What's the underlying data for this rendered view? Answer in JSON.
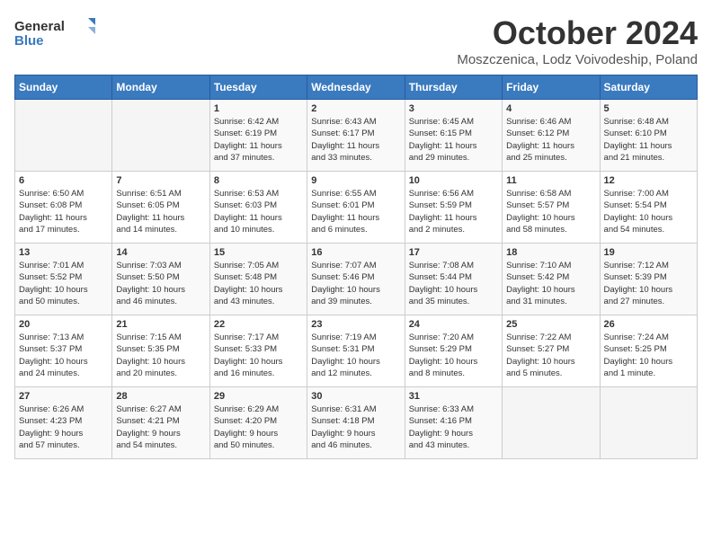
{
  "header": {
    "logo_general": "General",
    "logo_blue": "Blue",
    "month": "October 2024",
    "location": "Moszczenica, Lodz Voivodeship, Poland"
  },
  "weekdays": [
    "Sunday",
    "Monday",
    "Tuesday",
    "Wednesday",
    "Thursday",
    "Friday",
    "Saturday"
  ],
  "weeks": [
    [
      {
        "day": "",
        "info": ""
      },
      {
        "day": "",
        "info": ""
      },
      {
        "day": "1",
        "info": "Sunrise: 6:42 AM\nSunset: 6:19 PM\nDaylight: 11 hours\nand 37 minutes."
      },
      {
        "day": "2",
        "info": "Sunrise: 6:43 AM\nSunset: 6:17 PM\nDaylight: 11 hours\nand 33 minutes."
      },
      {
        "day": "3",
        "info": "Sunrise: 6:45 AM\nSunset: 6:15 PM\nDaylight: 11 hours\nand 29 minutes."
      },
      {
        "day": "4",
        "info": "Sunrise: 6:46 AM\nSunset: 6:12 PM\nDaylight: 11 hours\nand 25 minutes."
      },
      {
        "day": "5",
        "info": "Sunrise: 6:48 AM\nSunset: 6:10 PM\nDaylight: 11 hours\nand 21 minutes."
      }
    ],
    [
      {
        "day": "6",
        "info": "Sunrise: 6:50 AM\nSunset: 6:08 PM\nDaylight: 11 hours\nand 17 minutes."
      },
      {
        "day": "7",
        "info": "Sunrise: 6:51 AM\nSunset: 6:05 PM\nDaylight: 11 hours\nand 14 minutes."
      },
      {
        "day": "8",
        "info": "Sunrise: 6:53 AM\nSunset: 6:03 PM\nDaylight: 11 hours\nand 10 minutes."
      },
      {
        "day": "9",
        "info": "Sunrise: 6:55 AM\nSunset: 6:01 PM\nDaylight: 11 hours\nand 6 minutes."
      },
      {
        "day": "10",
        "info": "Sunrise: 6:56 AM\nSunset: 5:59 PM\nDaylight: 11 hours\nand 2 minutes."
      },
      {
        "day": "11",
        "info": "Sunrise: 6:58 AM\nSunset: 5:57 PM\nDaylight: 10 hours\nand 58 minutes."
      },
      {
        "day": "12",
        "info": "Sunrise: 7:00 AM\nSunset: 5:54 PM\nDaylight: 10 hours\nand 54 minutes."
      }
    ],
    [
      {
        "day": "13",
        "info": "Sunrise: 7:01 AM\nSunset: 5:52 PM\nDaylight: 10 hours\nand 50 minutes."
      },
      {
        "day": "14",
        "info": "Sunrise: 7:03 AM\nSunset: 5:50 PM\nDaylight: 10 hours\nand 46 minutes."
      },
      {
        "day": "15",
        "info": "Sunrise: 7:05 AM\nSunset: 5:48 PM\nDaylight: 10 hours\nand 43 minutes."
      },
      {
        "day": "16",
        "info": "Sunrise: 7:07 AM\nSunset: 5:46 PM\nDaylight: 10 hours\nand 39 minutes."
      },
      {
        "day": "17",
        "info": "Sunrise: 7:08 AM\nSunset: 5:44 PM\nDaylight: 10 hours\nand 35 minutes."
      },
      {
        "day": "18",
        "info": "Sunrise: 7:10 AM\nSunset: 5:42 PM\nDaylight: 10 hours\nand 31 minutes."
      },
      {
        "day": "19",
        "info": "Sunrise: 7:12 AM\nSunset: 5:39 PM\nDaylight: 10 hours\nand 27 minutes."
      }
    ],
    [
      {
        "day": "20",
        "info": "Sunrise: 7:13 AM\nSunset: 5:37 PM\nDaylight: 10 hours\nand 24 minutes."
      },
      {
        "day": "21",
        "info": "Sunrise: 7:15 AM\nSunset: 5:35 PM\nDaylight: 10 hours\nand 20 minutes."
      },
      {
        "day": "22",
        "info": "Sunrise: 7:17 AM\nSunset: 5:33 PM\nDaylight: 10 hours\nand 16 minutes."
      },
      {
        "day": "23",
        "info": "Sunrise: 7:19 AM\nSunset: 5:31 PM\nDaylight: 10 hours\nand 12 minutes."
      },
      {
        "day": "24",
        "info": "Sunrise: 7:20 AM\nSunset: 5:29 PM\nDaylight: 10 hours\nand 8 minutes."
      },
      {
        "day": "25",
        "info": "Sunrise: 7:22 AM\nSunset: 5:27 PM\nDaylight: 10 hours\nand 5 minutes."
      },
      {
        "day": "26",
        "info": "Sunrise: 7:24 AM\nSunset: 5:25 PM\nDaylight: 10 hours\nand 1 minute."
      }
    ],
    [
      {
        "day": "27",
        "info": "Sunrise: 6:26 AM\nSunset: 4:23 PM\nDaylight: 9 hours\nand 57 minutes."
      },
      {
        "day": "28",
        "info": "Sunrise: 6:27 AM\nSunset: 4:21 PM\nDaylight: 9 hours\nand 54 minutes."
      },
      {
        "day": "29",
        "info": "Sunrise: 6:29 AM\nSunset: 4:20 PM\nDaylight: 9 hours\nand 50 minutes."
      },
      {
        "day": "30",
        "info": "Sunrise: 6:31 AM\nSunset: 4:18 PM\nDaylight: 9 hours\nand 46 minutes."
      },
      {
        "day": "31",
        "info": "Sunrise: 6:33 AM\nSunset: 4:16 PM\nDaylight: 9 hours\nand 43 minutes."
      },
      {
        "day": "",
        "info": ""
      },
      {
        "day": "",
        "info": ""
      }
    ]
  ]
}
